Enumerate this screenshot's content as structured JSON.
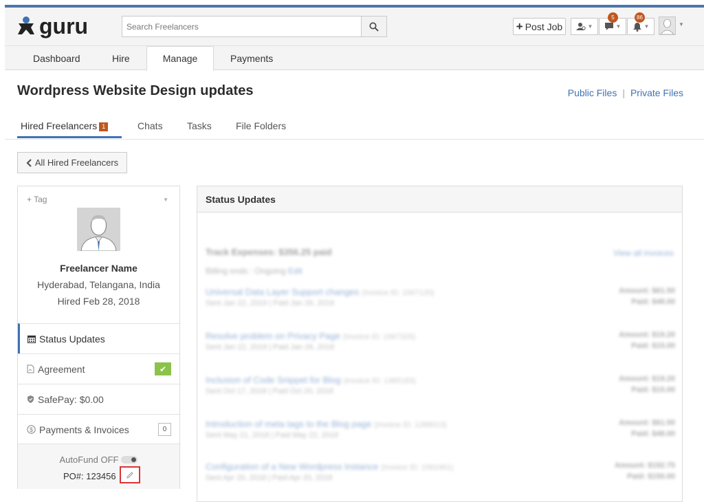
{
  "header": {
    "logo_text": "guru",
    "search": {
      "placeholder": "Search Freelancers"
    },
    "post_job_label": "Post Job",
    "messages_badge": "5",
    "notifications_badge": "86"
  },
  "nav": {
    "items": [
      "Dashboard",
      "Hire",
      "Manage",
      "Payments"
    ],
    "active": "Manage"
  },
  "page": {
    "title": "Wordpress Website Design updates",
    "public_files": "Public Files",
    "separator": "|",
    "private_files": "Private Files"
  },
  "subtabs": {
    "hired_freelancers": "Hired Freelancers",
    "hired_count": "1",
    "chats": "Chats",
    "tasks": "Tasks",
    "file_folders": "File Folders"
  },
  "back_button": "All Hired Freelancers",
  "freelancer": {
    "tag": "+ Tag",
    "name": "Freelancer Name",
    "location": "Hyderabad, Telangana, India",
    "hired": "Hired Feb 28, 2018"
  },
  "menu": {
    "status_updates": "Status Updates",
    "agreement": "Agreement",
    "safepay": "SafePay: $0.00",
    "payments_invoices": "Payments & Invoices",
    "payments_count": "0"
  },
  "autofund": {
    "label": "AutoFund OFF",
    "po": "PO#: 123456"
  },
  "status_panel": {
    "title": "Status Updates",
    "summary": "Track Expenses: $356.25 paid",
    "view_all": "View all invoices",
    "billing_label": "Billing ends : Ongoing",
    "billing_link": "Edit",
    "invoices": [
      {
        "title": "Universal Data Layer Support changes",
        "ref": "(Invoice ID: 1567120)",
        "dates": "Sent Jan 22, 2019 | Paid Jan 26, 2019",
        "amount": "Amount: $61.50",
        "paid": "Paid: $48.00"
      },
      {
        "title": "Resolve problem on Privacy Page",
        "ref": "(Invoice ID: 1567325)",
        "dates": "Sent Jan 22, 2019 | Paid Jan 26, 2019",
        "amount": "Amount: $19.20",
        "paid": "Paid: $15.00"
      },
      {
        "title": "Inclusion of Code Snippet for Blog",
        "ref": "(Invoice ID: 1365183)",
        "dates": "Sent Oct 17, 2018 | Paid Oct 20, 2018",
        "amount": "Amount: $19.20",
        "paid": "Paid: $15.00"
      },
      {
        "title": "Introduction of meta tags to the Blog page",
        "ref": "(Invoice ID: 1268013)",
        "dates": "Sent May 21, 2018 | Paid May 22, 2018",
        "amount": "Amount: $61.50",
        "paid": "Paid: $48.00"
      },
      {
        "title": "Configuration of a New Wordpress Instance",
        "ref": "(Invoice ID: 1562461)",
        "dates": "Sent Apr 20, 2018 | Paid Apr 20, 2018",
        "amount": "Amount: $192.75",
        "paid": "Paid: $150.00"
      }
    ]
  },
  "colors": {
    "brand_blue": "#3f72b4",
    "accent_orange": "#c0571f",
    "check_green": "#8bc34a"
  }
}
